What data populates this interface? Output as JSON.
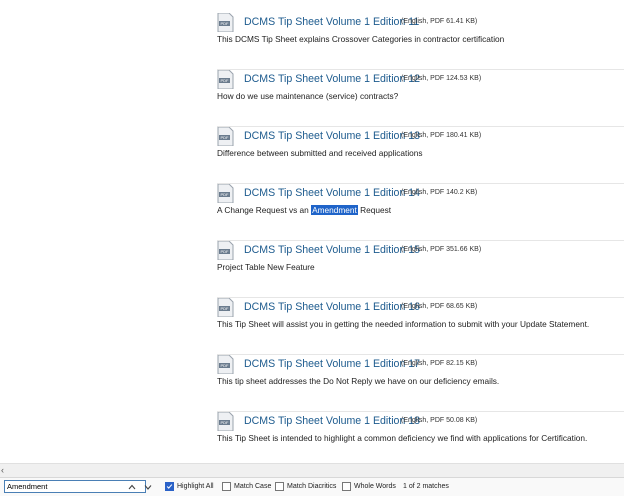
{
  "documents": [
    {
      "title": "DCMS Tip Sheet Volume 1 Edition 11",
      "meta": "(English, PDF 61.41 KB)",
      "desc": "This DCMS Tip Sheet explains Crossover Categories in contractor certification"
    },
    {
      "title": "DCMS Tip Sheet Volume 1 Edition 12",
      "meta": "(English, PDF 124.53 KB)",
      "desc": "How do we use maintenance (service) contracts?"
    },
    {
      "title": "DCMS Tip Sheet Volume 1 Edition 13",
      "meta": "(English, PDF 180.41 KB)",
      "desc": "Difference between submitted and received applications"
    },
    {
      "title": "DCMS Tip Sheet Volume 1 Edition 14",
      "meta": "(English, PDF 140.2 KB)",
      "desc_before": "A Change Request vs an ",
      "desc_highlight": "Amendment",
      "desc_after": " Request"
    },
    {
      "title": "DCMS Tip Sheet Volume 1 Edition 15",
      "meta": "(English, PDF 351.66 KB)",
      "desc": "Project Table New Feature"
    },
    {
      "title": "DCMS Tip Sheet Volume 1 Edition 16",
      "meta": "(English, PDF 68.65 KB)",
      "desc": "This Tip Sheet will assist you in getting the needed information to submit with your Update Statement."
    },
    {
      "title": "DCMS Tip Sheet Volume 1 Edition 17",
      "meta": "(English, PDF 82.15 KB)",
      "desc": "This tip sheet addresses the Do Not Reply we have on our deficiency emails."
    },
    {
      "title": "DCMS Tip Sheet Volume 1 Edition 18",
      "meta": "(English, PDF 50.08 KB)",
      "desc": "This Tip Sheet is intended to highlight a common deficiency we find with applications for Certification."
    }
  ],
  "icons": {
    "pdf": "pdf-icon",
    "prev": "chevron-up-icon",
    "next": "chevron-down-icon",
    "scroll_left": "chevron-left-icon"
  },
  "findbar": {
    "query": "Amendment",
    "highlight_all": "Highlight All",
    "highlight_all_checked": true,
    "match_case": "Match Case",
    "match_diacritics": "Match Diacritics",
    "whole_words": "Whole Words",
    "status": "1 of 2 matches"
  },
  "colors": {
    "link": "#1d5b8e",
    "highlight": "#1f64c9",
    "checkbox_on": "#2b62c8"
  }
}
